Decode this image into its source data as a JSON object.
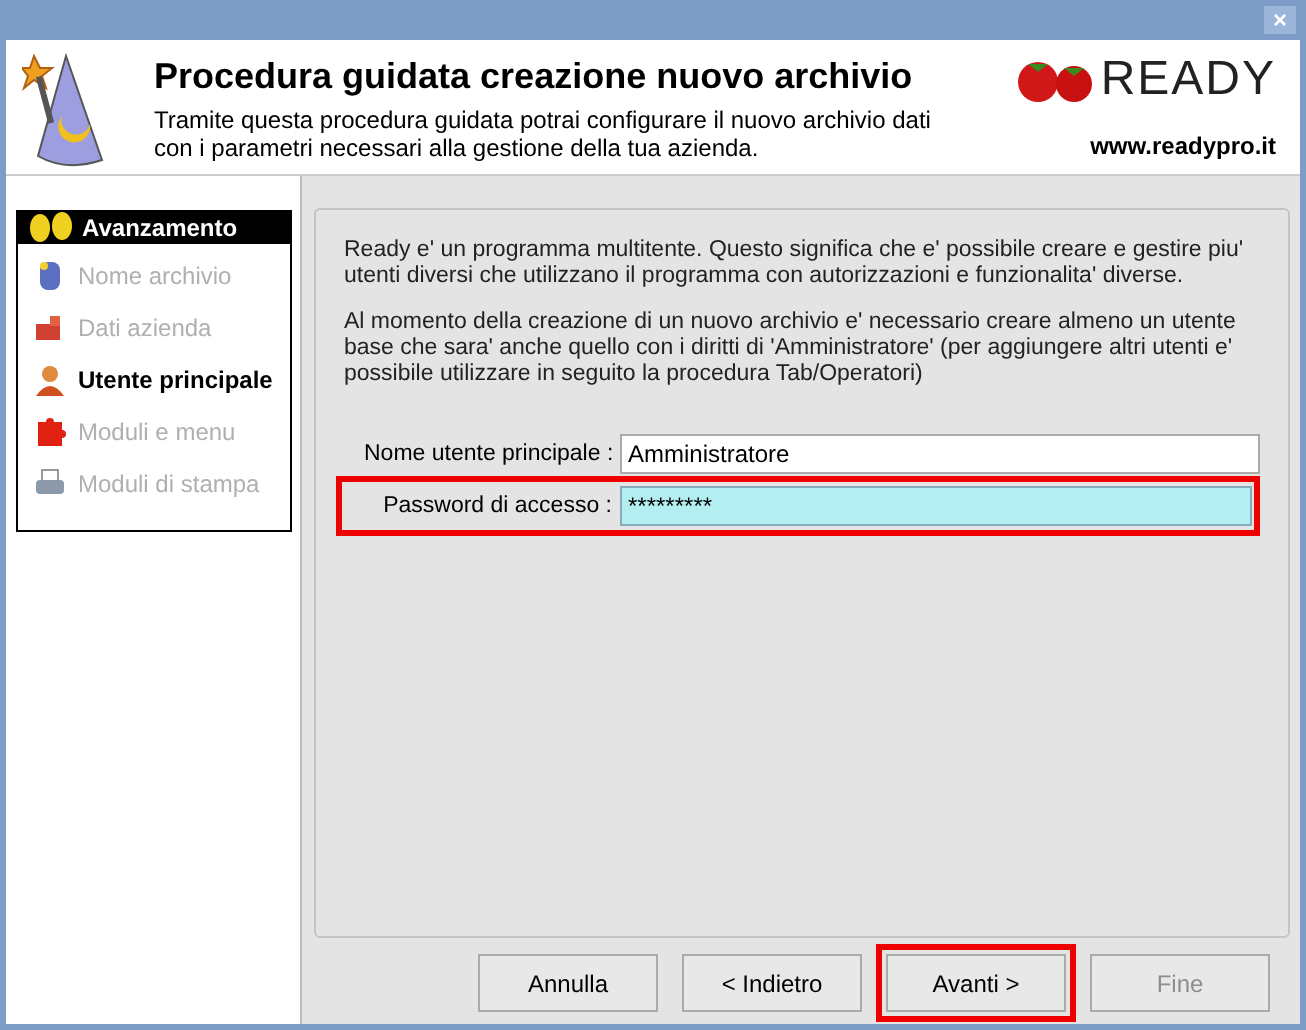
{
  "window": {
    "close": "×"
  },
  "header": {
    "title": "Procedura guidata creazione nuovo archivio",
    "description": "Tramite questa procedura guidata potrai configurare il nuovo archivio dati con i parametri necessari alla gestione della tua azienda.",
    "brand": "READY",
    "website": "www.readypro.it"
  },
  "progress": {
    "title": "Avanzamento",
    "steps": [
      {
        "label": "Nome archivio",
        "kind": "database",
        "selected": false
      },
      {
        "label": "Dati azienda",
        "kind": "company",
        "selected": false
      },
      {
        "label": "Utente principale",
        "kind": "user",
        "selected": true
      },
      {
        "label": "Moduli e menu",
        "kind": "puzzle",
        "selected": false
      },
      {
        "label": "Moduli di stampa",
        "kind": "printer",
        "selected": false
      }
    ]
  },
  "content": {
    "paragraphs": [
      "Ready e' un programma multitente. Questo significa che e' possibile creare e gestire piu' utenti diversi che utilizzano il programma con autorizzazioni e funzionalita' diverse.",
      "Al momento della creazione di un nuovo archivio e' necessario creare almeno un utente base che sara' anche quello con i diritti di 'Amministratore' (per aggiungere altri utenti e' possibile utilizzare in seguito la procedura Tab/Operatori)"
    ],
    "fields": [
      {
        "label": "Nome utente principale :",
        "value": "Amministratore",
        "focused": false,
        "highlighted": false
      },
      {
        "label": "Password di accesso :",
        "value": "*********",
        "focused": true,
        "highlighted": true
      }
    ]
  },
  "buttons": [
    {
      "label": "Annulla",
      "disabled": false,
      "highlighted": false
    },
    {
      "label": "< Indietro",
      "disabled": false,
      "highlighted": false
    },
    {
      "label": "Avanti >",
      "disabled": false,
      "highlighted": true
    },
    {
      "label": "Fine",
      "disabled": true,
      "highlighted": false
    }
  ]
}
